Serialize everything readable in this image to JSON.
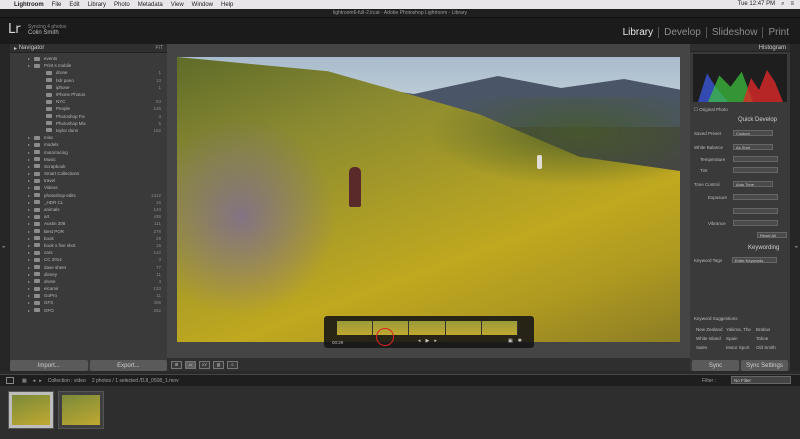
{
  "menubar": {
    "app": "Lightroom",
    "items": [
      "File",
      "Edit",
      "Library",
      "Photo",
      "Metadata",
      "View",
      "Window",
      "Help"
    ],
    "clock": "Tue 12:47 PM"
  },
  "window": {
    "title": "lightroom6-full-2.lrcat - Adobe Photoshop Lightroom - Library"
  },
  "identity": {
    "logo": "Lr",
    "sync_status": "Syncing 4 photos",
    "user": "Colin Smith"
  },
  "modules": [
    "Library",
    "Develop",
    "Slideshow",
    "Print"
  ],
  "left_panel": {
    "navigator_title": "Navigator",
    "navigator_fit": "FIT",
    "folders": [
      {
        "name": "events",
        "count": ""
      },
      {
        "name": "Print s mobile",
        "count": ""
      },
      {
        "name": "drone",
        "count": "1"
      },
      {
        "name": "hdr pano",
        "count": "13"
      },
      {
        "name": "iphone",
        "count": "1"
      },
      {
        "name": "iPhone Photos",
        "count": ""
      },
      {
        "name": "NYC",
        "count": "53"
      },
      {
        "name": "People",
        "count": "136"
      },
      {
        "name": "Photoshop Fix",
        "count": "3"
      },
      {
        "name": "Photoshop Mix",
        "count": "5"
      },
      {
        "name": "taylor dunn",
        "count": "152"
      },
      {
        "name": "misc",
        "count": ""
      },
      {
        "name": "models",
        "count": ""
      },
      {
        "name": "motorracing",
        "count": ""
      },
      {
        "name": "Music",
        "count": ""
      },
      {
        "name": "Scrapbook",
        "count": ""
      },
      {
        "name": "Smart Collections",
        "count": ""
      },
      {
        "name": "travel",
        "count": ""
      },
      {
        "name": "Videos",
        "count": ""
      },
      {
        "name": "photoshop edits",
        "count": "1312"
      },
      {
        "name": "_HDR CL",
        "count": "16"
      },
      {
        "name": "animals",
        "count": "140"
      },
      {
        "name": "art",
        "count": "436"
      },
      {
        "name": "Austin 308",
        "count": "111"
      },
      {
        "name": "Best POR",
        "count": "278"
      },
      {
        "name": "book",
        "count": "25"
      },
      {
        "name": "book s five shot",
        "count": "15"
      },
      {
        "name": "cars",
        "count": "142"
      },
      {
        "name": "CC 2014",
        "count": "3"
      },
      {
        "name": "dave sheet",
        "count": "77"
      },
      {
        "name": "disney",
        "count": "11"
      },
      {
        "name": "drone",
        "count": "3"
      },
      {
        "name": "elcamir",
        "count": "133"
      },
      {
        "name": "GoPro",
        "count": "11"
      },
      {
        "name": "GFS",
        "count": "406"
      },
      {
        "name": "GFO",
        "count": "262"
      }
    ],
    "import_label": "Import...",
    "export_label": "Export..."
  },
  "video": {
    "time": "00:29",
    "controls": [
      "◂",
      "▶",
      "▸"
    ]
  },
  "toolbar": {
    "views": [
      "⊞",
      "▭",
      "XY",
      "▥",
      "☺"
    ]
  },
  "right_panel": {
    "histogram_title": "Histogram",
    "original_photo": "Original Photo",
    "quick_develop_title": "Quick Develop",
    "saved_preset_label": "Saved Preset",
    "saved_preset_value": "Custom",
    "white_balance_label": "White Balance",
    "white_balance_value": "As Shot",
    "temperature_label": "Temperature",
    "tint_label": "Tint",
    "tone_control_label": "Tone Control",
    "auto_tone_label": "Auto Tone",
    "exposure_label": "Exposure",
    "vibrance_label": "Vibrance",
    "reset_all_label": "Reset All",
    "keywording_title": "Keywording",
    "keyword_tags_label": "Keyword Tags",
    "keyword_tags_value": "Enter Keywords",
    "keyword_suggestions_title": "Keyword Suggestions",
    "suggestions": [
      "New Zealand",
      "Yakima, The",
      "Brabus",
      "White Island",
      "Spain",
      "Tahoe",
      "Sales",
      "Motor Sport",
      "Old Smith"
    ],
    "sync_label": "Sync",
    "sync_settings_label": "Sync Settings"
  },
  "filmstrip": {
    "collection_info": "Collection : video",
    "selection_info": "2 photos / 1 selected /DJI_0508_1.mov",
    "filter_label": "Filter :",
    "filter_value": "No Filter"
  },
  "colors": {
    "accent": "#d9d9d9",
    "panel": "#3a3a3a",
    "background": "#2a2a2a"
  }
}
